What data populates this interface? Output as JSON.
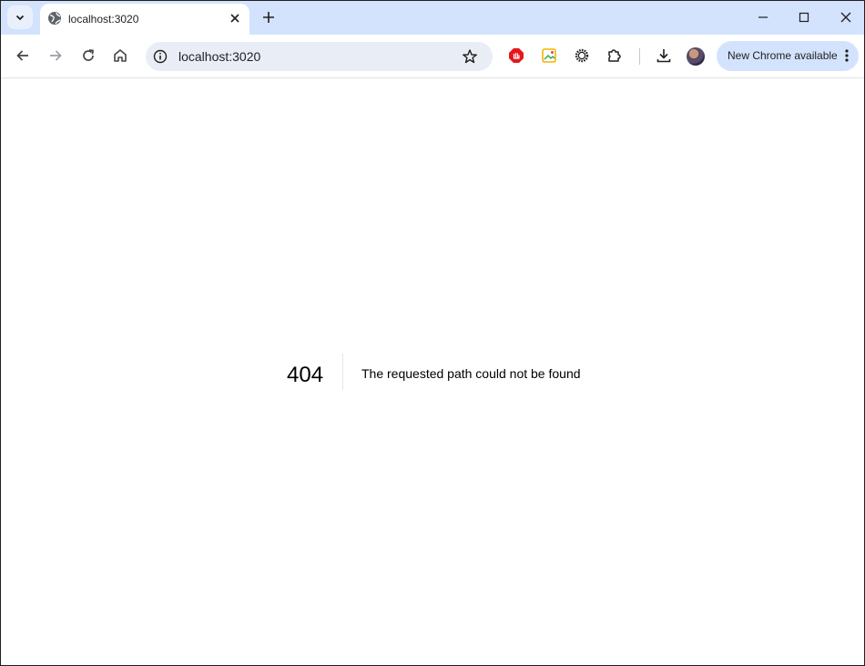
{
  "tab": {
    "title": "localhost:3020"
  },
  "omnibox": {
    "url": "localhost:3020"
  },
  "toolbar": {
    "update_label": "New Chrome available"
  },
  "page": {
    "code": "404",
    "message": "The requested path could not be found"
  },
  "colors": {
    "tabstrip": "#d3e3fd",
    "omnibox": "#e9eef6",
    "pill": "#d3e3fd",
    "adblock": "#e8161d"
  }
}
